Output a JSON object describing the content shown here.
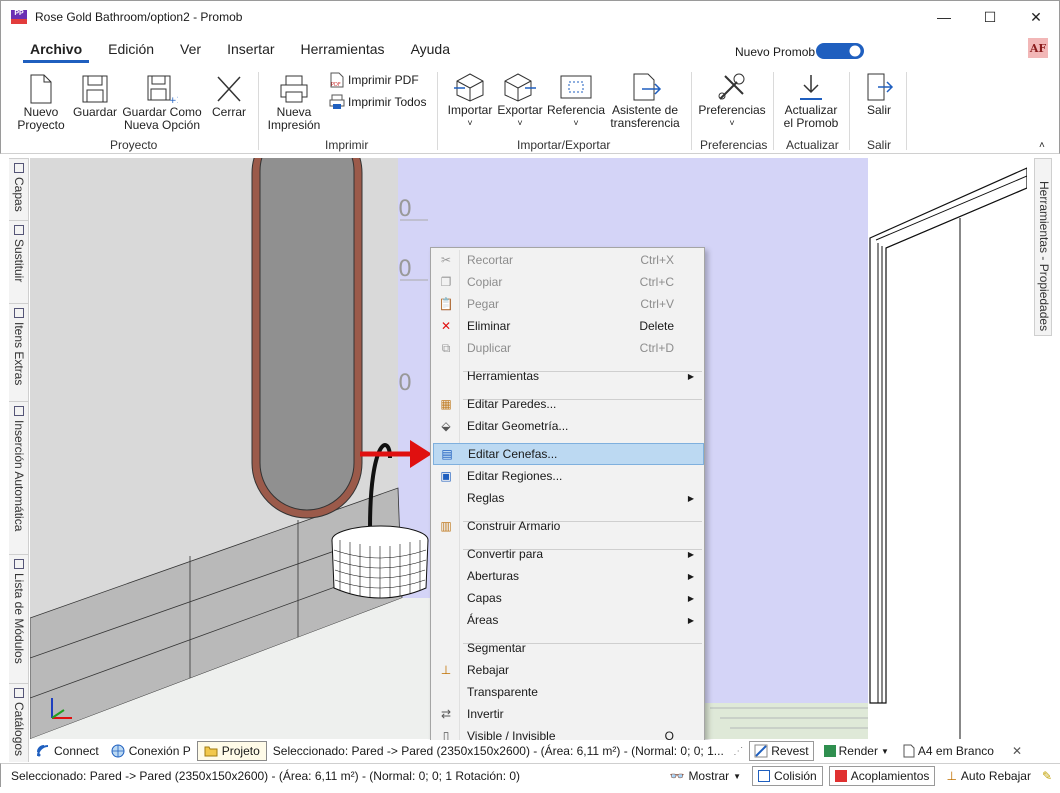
{
  "window": {
    "title": "Rose Gold Bathroom/option2 - Promob",
    "min": "—",
    "max": "☐",
    "close": "✕"
  },
  "menu": {
    "items": [
      "Archivo",
      "Edición",
      "Ver",
      "Insertar",
      "Herramientas",
      "Ayuda"
    ],
    "nuevo_promob": "Nuevo Promob",
    "user_badge": "AF"
  },
  "ribbon": {
    "nuevo_proyecto": "Nuevo\nProyecto",
    "guardar": "Guardar",
    "guardar_como": "Guardar Como\nNueva Opción",
    "cerrar": "Cerrar",
    "nueva_impresion": "Nueva\nImpresión",
    "imprimir_pdf": "Imprimir PDF",
    "imprimir_todos": "Imprimir Todos",
    "importar": "Importar",
    "exportar": "Exportar",
    "referencia": "Referencia",
    "asistente": "Asistente de\ntransferencia",
    "preferencias": "Preferencias",
    "actualizar": "Actualizar\nel Promob",
    "salir": "Salir",
    "groups": {
      "proyecto": "Proyecto",
      "imprimir": "Imprimir",
      "importar_exportar": "Importar/Exportar",
      "preferencias": "Preferencias",
      "actualizar": "Actualizar",
      "salir": "Salir"
    }
  },
  "left_tabs": [
    "Capas",
    "Sustituir",
    "Itens Extras",
    "Inserción Automática",
    "Lista de Módulos",
    "Catálogos"
  ],
  "right_tab": "Herramientas - Propiedades",
  "context_menu": {
    "items": [
      {
        "label": "Recortar",
        "shortcut": "Ctrl+X",
        "disabled": true
      },
      {
        "label": "Copiar",
        "shortcut": "Ctrl+C",
        "disabled": true
      },
      {
        "label": "Pegar",
        "shortcut": "Ctrl+V",
        "disabled": true
      },
      {
        "label": "Eliminar",
        "shortcut": "Delete",
        "disabled": false
      },
      {
        "label": "Duplicar",
        "shortcut": "Ctrl+D",
        "disabled": true
      },
      {
        "label": "Herramientas",
        "submenu": true
      },
      {
        "label": "Editar Paredes..."
      },
      {
        "label": "Editar Geometría..."
      },
      {
        "label": "Editar Cenefas...",
        "highlighted": true
      },
      {
        "label": "Editar Regiones..."
      },
      {
        "label": "Reglas",
        "submenu": true
      },
      {
        "label": "Construir Armario"
      },
      {
        "label": "Convertir para",
        "submenu": true
      },
      {
        "label": "Aberturas",
        "submenu": true
      },
      {
        "label": "Capas",
        "submenu": true
      },
      {
        "label": "Áreas",
        "submenu": true
      },
      {
        "label": "Segmentar"
      },
      {
        "label": "Rebajar"
      },
      {
        "label": "Transparente"
      },
      {
        "label": "Invertir"
      },
      {
        "label": "Visible / Invisible",
        "shortcut": "O"
      }
    ]
  },
  "doc_bar": {
    "tabs": [
      "Connect",
      "Conexión P",
      "Projeto"
    ],
    "status": "Seleccionado: Pared -> Pared (2350x150x2600) - (Área: 6,11 m²) - (Normal: 0; 0; 1...",
    "revest": "Revest",
    "render": "Render",
    "a4": "A4 em Branco"
  },
  "status_bar": {
    "text": "Seleccionado: Pared -> Pared (2350x150x2600) - (Área: 6,11 m²) - (Normal: 0; 0; 1 Rotación: 0)",
    "mostrar": "Mostrar",
    "colision": "Colisión",
    "acoplamientos": "Acoplamientos",
    "auto_rebajar": "Auto Rebajar"
  },
  "colors": {
    "accent": "#1f5fbf",
    "wall_blue": "#d4d4f7",
    "highlight": "#bcd9f2",
    "arrow_red": "#e01010"
  }
}
